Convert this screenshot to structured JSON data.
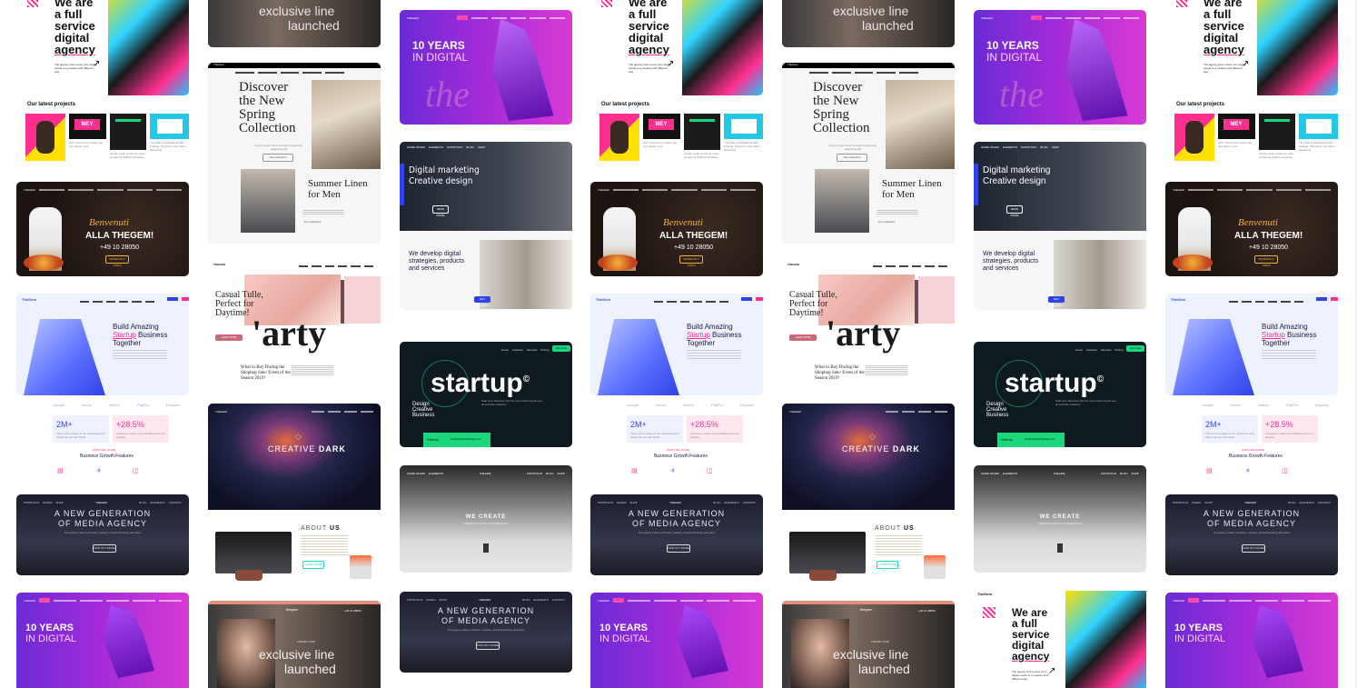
{
  "colors": {
    "pink": "#ff2f8e",
    "purple": "#8e2bd8",
    "blue": "#2f43e8",
    "green": "#19d77a",
    "gold": "#f2b138"
  },
  "agency": {
    "brand": "TheGem",
    "headline": [
      "We are",
      "a full",
      "service",
      "digital",
      "agency"
    ],
    "caption": "The agency that moves your digital needs to a creative and different way",
    "latest": "Our latest projects",
    "p1": "UNIT Interactive mobile app and design work",
    "p2": "Social media profile for mass streaming platform template",
    "p3": "The Path of Spiritual Kit with Collage, Workshop and Video Marketing"
  },
  "fashion1": {
    "logo": "TheGem",
    "nav": [
      "Products Page",
      "Categories",
      "Blog",
      "Shop",
      "Elements"
    ],
    "title": [
      "Discover",
      "the New",
      "Spring",
      "Collection"
    ],
    "sub": "Lorem ipsum dolor sit amet consectetur adipiscing elit",
    "btn": "Get Collection",
    "title2": [
      "Summer Linen",
      "for Men"
    ],
    "btn2": "Get Collection"
  },
  "purple": {
    "logo": "THEGEM",
    "title1": "10 YEARS",
    "title2": "IN DIGITAL",
    "script": "the"
  },
  "exclusive": {
    "line1": "exclusive line",
    "line2": "launched",
    "tag": "LIMITED TIME"
  },
  "restaurant": {
    "logo": "THEGEM",
    "script": "Benvenuti",
    "title": "ALLA THEGEM!",
    "phone": "+49 10 28050",
    "btn": "RESERVE A TABLE"
  },
  "tulle": {
    "logo": "THEGEM",
    "nav": [
      "HOME",
      "COLLECTIONS",
      "CATEGORIES",
      "PRODUCTS",
      "NEW IN",
      "STORES"
    ],
    "title": [
      "Casual Tulle,",
      "Perfect for",
      "Daytime!"
    ],
    "big": "'arty",
    "btn": "SHOP NOW",
    "article": [
      "What to Buy During the",
      "Shopbop Sale: Event of the",
      "Season 2019!"
    ]
  },
  "digital": {
    "nav": [
      "HOME PAGES",
      "ELEMENTS",
      "PORTFOLIO",
      "BLOG",
      "SHOP"
    ],
    "title": [
      "Digital marketing",
      "Creative design"
    ],
    "btn": "READ MORE",
    "sub": [
      "We develop digital",
      "strategies, products",
      "and services"
    ],
    "btn2": "GET STARTED"
  },
  "startup_biz": {
    "logo": "TheGem",
    "nav": [
      "Home",
      "Features",
      "Services",
      "Pricing",
      "News",
      "FAQ"
    ],
    "title": [
      "Build Amazing",
      "Startup",
      "Business",
      "Together"
    ],
    "brands": [
      "Google",
      "ebook",
      "Airbnb",
      "PayPal",
      "Dropbox"
    ],
    "stat1": "2M+",
    "stat2": "+28.5%",
    "stat_txt1": "This is the number of our customers and clients all over the world",
    "stat_txt2": "Increase in sales and marketing with our devices",
    "features_tag": "WHAT WE OFFER",
    "features": "Business Growth Features"
  },
  "startup": {
    "nav": [
      "Home",
      "Features",
      "Services",
      "Pricing",
      "News",
      "FAQ"
    ],
    "btn": "Buy Now",
    "word": "startup",
    "copy": "©",
    "vert": [
      "Design",
      "Creative",
      "Business"
    ],
    "desc": "Start your business with the team that brought you all possible solutions",
    "tag": "Startup",
    "email": "info@thegemstartup.com"
  },
  "creative_dark": {
    "logo": "THEGEM",
    "title1": "CREATIVE",
    "title2": "DARK",
    "about1": "ABOUT",
    "about2": "US",
    "btn": "LEARN MORE"
  },
  "wecreate": {
    "logo": "THEGEM",
    "nav": [
      "HOME PAGES",
      "ELEMENTS",
      "PORTFOLIO",
      "BLOG",
      "SHOP"
    ],
    "title": "WE CREATE",
    "sub": "PREMIUM DIGITAL EXPERIENCES"
  },
  "media": {
    "logo": "THEGEM",
    "nav": [
      "PORTFOLIO",
      "PAGES",
      "SHOP"
    ],
    "nav_r": [
      "BLOG",
      "ELEMENTS",
      "CONTACT"
    ],
    "title1": "A NEW GENERATION",
    "title2": "OF MEDIA AGENCY",
    "sub": "Our agency takes a holistic, creative, forward-thinking approach",
    "btn": "FIND OUT MORE"
  },
  "beauty": {
    "logo": "thegem",
    "phone": "+49 10 28050",
    "line1": "exclusive line",
    "line2": "launched",
    "tag": "LIMITED TIME"
  }
}
